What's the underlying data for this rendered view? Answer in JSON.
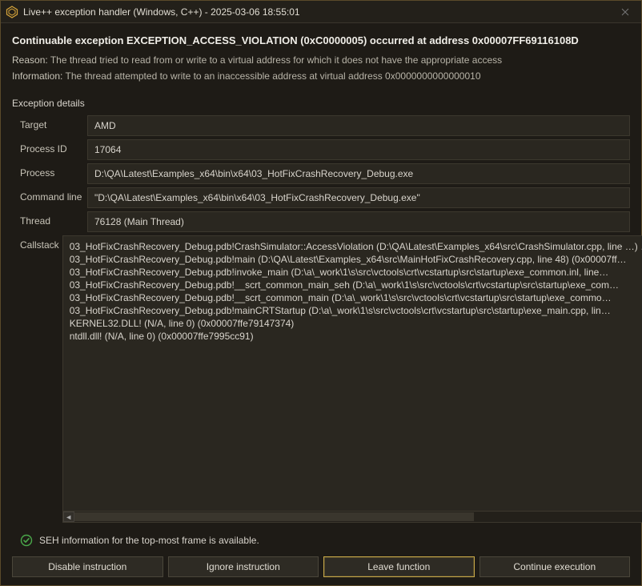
{
  "window": {
    "title": "Live++ exception handler (Windows, C++) - 2025-03-06 18:55:01"
  },
  "headline": "Continuable exception EXCEPTION_ACCESS_VIOLATION (0xC0000005) occurred at address 0x00007FF69116108D",
  "reason": {
    "label": "Reason:",
    "text": "The thread tried to read from or write to a virtual address for which it does not have the appropriate access"
  },
  "information": {
    "label": "Information:",
    "text": "The thread attempted to write to an inaccessible address at virtual address 0x0000000000000010"
  },
  "section_title": "Exception details",
  "fields": {
    "target": {
      "label": "Target",
      "value": "AMD"
    },
    "process_id": {
      "label": "Process ID",
      "value": "17064"
    },
    "process": {
      "label": "Process",
      "value": "D:\\QA\\Latest\\Examples_x64\\bin\\x64\\03_HotFixCrashRecovery_Debug.exe"
    },
    "command_line": {
      "label": "Command line",
      "value": "\"D:\\QA\\Latest\\Examples_x64\\bin\\x64\\03_HotFixCrashRecovery_Debug.exe\""
    },
    "thread": {
      "label": "Thread",
      "value": "76128 (Main Thread)"
    },
    "callstack": {
      "label": "Callstack"
    }
  },
  "callstack_lines": [
    "03_HotFixCrashRecovery_Debug.pdb!CrashSimulator::AccessViolation (D:\\QA\\Latest\\Examples_x64\\src\\CrashSimulator.cpp, line …) …",
    "03_HotFixCrashRecovery_Debug.pdb!main (D:\\QA\\Latest\\Examples_x64\\src\\MainHotFixCrashRecovery.cpp, line 48) (0x00007ff…",
    "03_HotFixCrashRecovery_Debug.pdb!invoke_main (D:\\a\\_work\\1\\s\\src\\vctools\\crt\\vcstartup\\src\\startup\\exe_common.inl, line…",
    "03_HotFixCrashRecovery_Debug.pdb!__scrt_common_main_seh (D:\\a\\_work\\1\\s\\src\\vctools\\crt\\vcstartup\\src\\startup\\exe_com…",
    "03_HotFixCrashRecovery_Debug.pdb!__scrt_common_main (D:\\a\\_work\\1\\s\\src\\vctools\\crt\\vcstartup\\src\\startup\\exe_commo…",
    "03_HotFixCrashRecovery_Debug.pdb!mainCRTStartup (D:\\a\\_work\\1\\s\\src\\vctools\\crt\\vcstartup\\src\\startup\\exe_main.cpp, lin…",
    "KERNEL32.DLL! (N/A, line 0) (0x00007ffe79147374)",
    "ntdll.dll! (N/A, line 0) (0x00007ffe7995cc91)"
  ],
  "status": "SEH information for the top-most frame is available.",
  "buttons": {
    "disable": "Disable instruction",
    "ignore": "Ignore instruction",
    "leave": "Leave function",
    "continue": "Continue execution"
  }
}
